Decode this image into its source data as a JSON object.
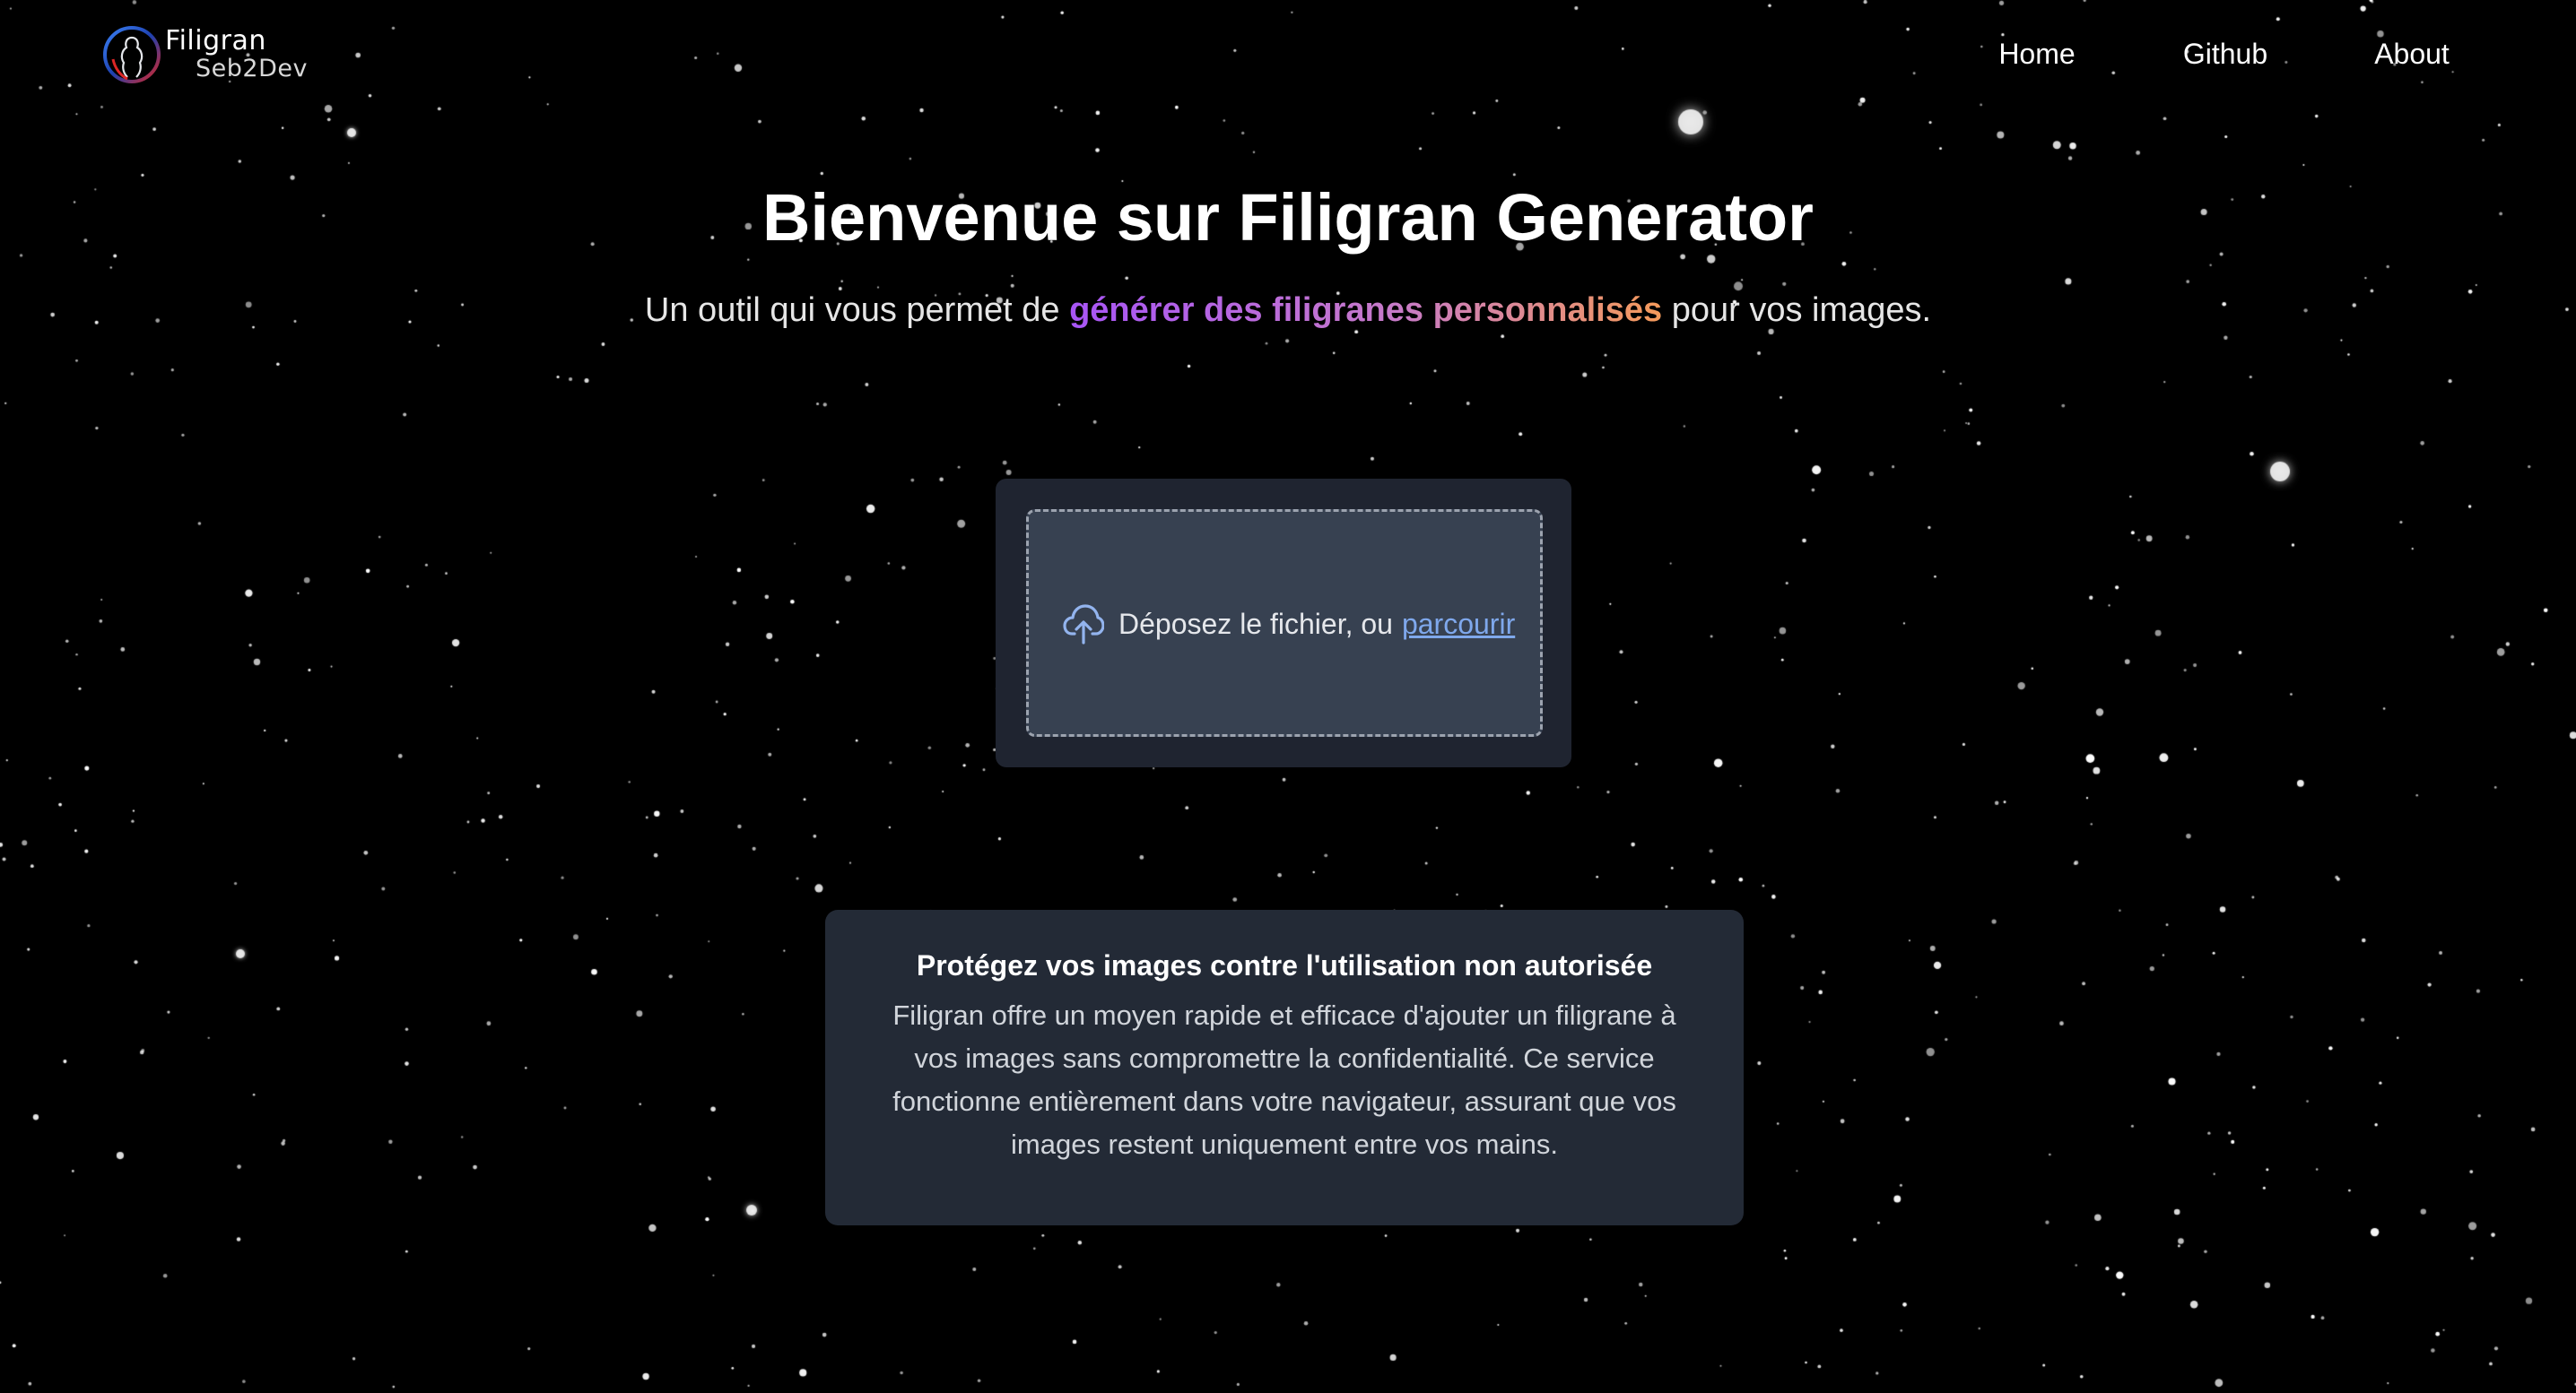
{
  "header": {
    "logo_title": "Filigran",
    "logo_subtitle": "Seb2Dev",
    "nav": [
      "Home",
      "Github",
      "About"
    ]
  },
  "hero": {
    "title": "Bienvenue sur Filigran Generator",
    "subtitle_prefix": "Un outil qui vous permet de",
    "subtitle_highlight": "générer des filigranes personnalisés",
    "subtitle_suffix": "pour vos images."
  },
  "upload": {
    "icon": "cloud-upload-icon",
    "text": "Déposez le fichier, ou",
    "link": "parcourir"
  },
  "info": {
    "title": "Protégez vos images contre l'utilisation non autorisée",
    "body": "Filigran offre un moyen rapide et efficace d'ajouter un filigrane à vos images sans compromettre la confidentialité. Ce service fonctionne entièrement dans votre navigateur, assurant que vos images restent uniquement entre vos mains."
  },
  "colors": {
    "background": "#000000",
    "upload_card": "#1f2430",
    "dropzone": "#374151",
    "info_card": "#232a36",
    "link": "#7fa8ec",
    "gradient_start": "#a855f7",
    "gradient_end": "#f59a5a"
  }
}
